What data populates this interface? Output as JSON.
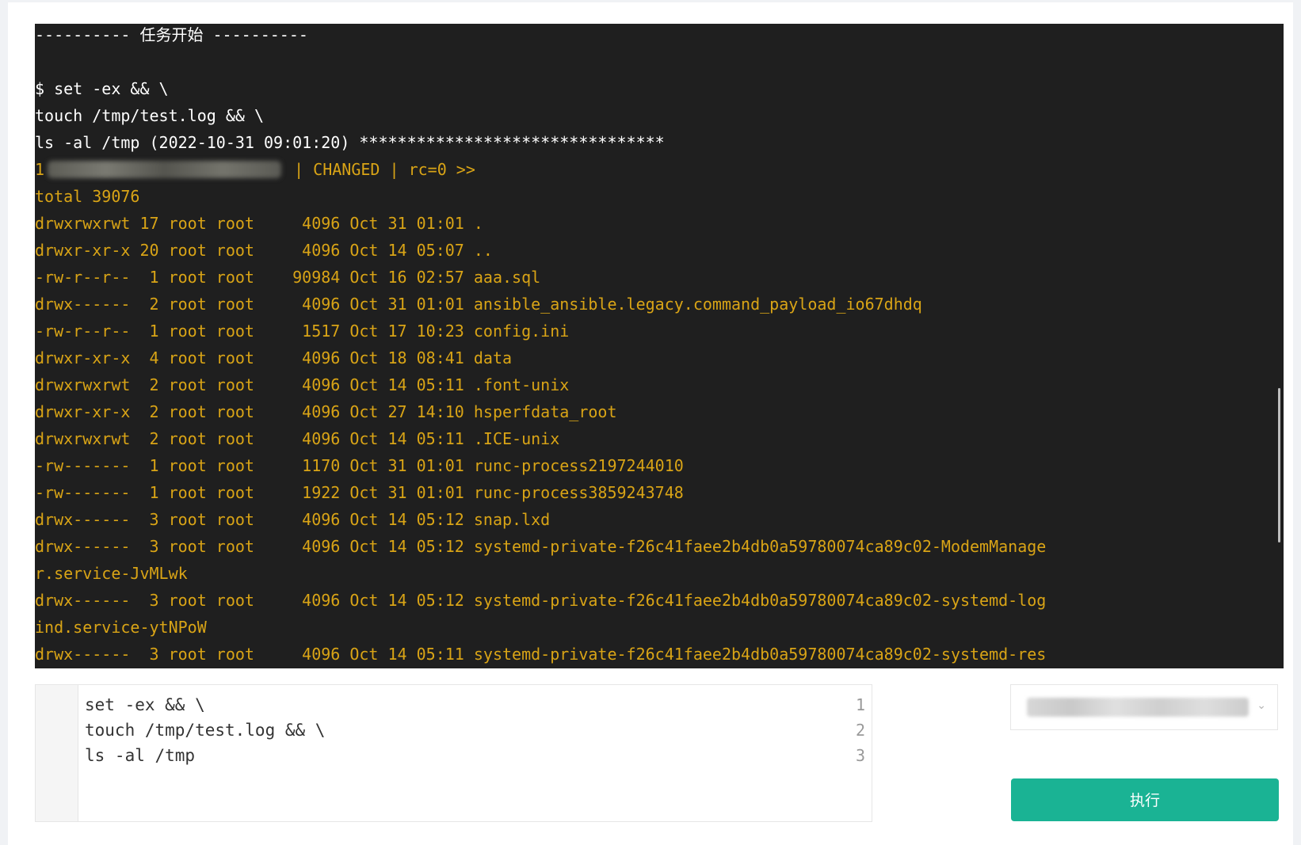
{
  "terminal": {
    "lines": [
      {
        "text": "---------- 任务开始 ----------",
        "color": "#ffffff"
      },
      {
        "text": "",
        "color": "#ffffff"
      },
      {
        "text": "$ set -ex && \\",
        "color": "#ffffff"
      },
      {
        "text": "touch /tmp/test.log && \\",
        "color": "#ffffff"
      },
      {
        "text": "ls -al /tmp (2022-10-31 09:01:20) ********************************",
        "color": "#ffffff"
      },
      {
        "text": "",
        "color": "#d9a416"
      },
      {
        "text": "total 39076",
        "color": "#d9a416"
      },
      {
        "text": "drwxrwxrwt 17 root root     4096 Oct 31 01:01 .",
        "color": "#d9a416"
      },
      {
        "text": "drwxr-xr-x 20 root root     4096 Oct 14 05:07 ..",
        "color": "#d9a416"
      },
      {
        "text": "-rw-r--r--  1 root root    90984 Oct 16 02:57 aaa.sql",
        "color": "#d9a416"
      },
      {
        "text": "drwx------  2 root root     4096 Oct 31 01:01 ansible_ansible.legacy.command_payload_io67dhdq",
        "color": "#d9a416"
      },
      {
        "text": "-rw-r--r--  1 root root     1517 Oct 17 10:23 config.ini",
        "color": "#d9a416"
      },
      {
        "text": "drwxr-xr-x  4 root root     4096 Oct 18 08:41 data",
        "color": "#d9a416"
      },
      {
        "text": "drwxrwxrwt  2 root root     4096 Oct 14 05:11 .font-unix",
        "color": "#d9a416"
      },
      {
        "text": "drwxr-xr-x  2 root root     4096 Oct 27 14:10 hsperfdata_root",
        "color": "#d9a416"
      },
      {
        "text": "drwxrwxrwt  2 root root     4096 Oct 14 05:11 .ICE-unix",
        "color": "#d9a416"
      },
      {
        "text": "-rw-------  1 root root     1170 Oct 31 01:01 runc-process2197244010",
        "color": "#d9a416"
      },
      {
        "text": "-rw-------  1 root root     1922 Oct 31 01:01 runc-process3859243748",
        "color": "#d9a416"
      },
      {
        "text": "drwx------  3 root root     4096 Oct 14 05:12 snap.lxd",
        "color": "#d9a416"
      },
      {
        "text": "drwx------  3 root root     4096 Oct 14 05:12 systemd-private-f26c41faee2b4db0a59780074ca89c02-ModemManage",
        "color": "#d9a416"
      },
      {
        "text": "r.service-JvMLwk",
        "color": "#d9a416"
      },
      {
        "text": "drwx------  3 root root     4096 Oct 14 05:12 systemd-private-f26c41faee2b4db0a59780074ca89c02-systemd-log",
        "color": "#d9a416"
      },
      {
        "text": "ind.service-ytNPoW",
        "color": "#d9a416"
      },
      {
        "text": "drwx------  3 root root     4096 Oct 14 05:11 systemd-private-f26c41faee2b4db0a59780074ca89c02-systemd-res",
        "color": "#d9a416"
      }
    ],
    "host_line": {
      "prefix": "1",
      "suffix": " | CHANGED | rc=0 >>",
      "color": "#d9a416"
    }
  },
  "editor": {
    "lines": [
      {
        "num": "1",
        "code": "set -ex && \\"
      },
      {
        "num": "2",
        "code": "touch /tmp/test.log && \\"
      },
      {
        "num": "3",
        "code": "ls -al /tmp"
      }
    ]
  },
  "target_select": {
    "arrow_icon": "chevron-down-icon"
  },
  "run_button": {
    "label": "执行",
    "color": "#1ab394"
  }
}
